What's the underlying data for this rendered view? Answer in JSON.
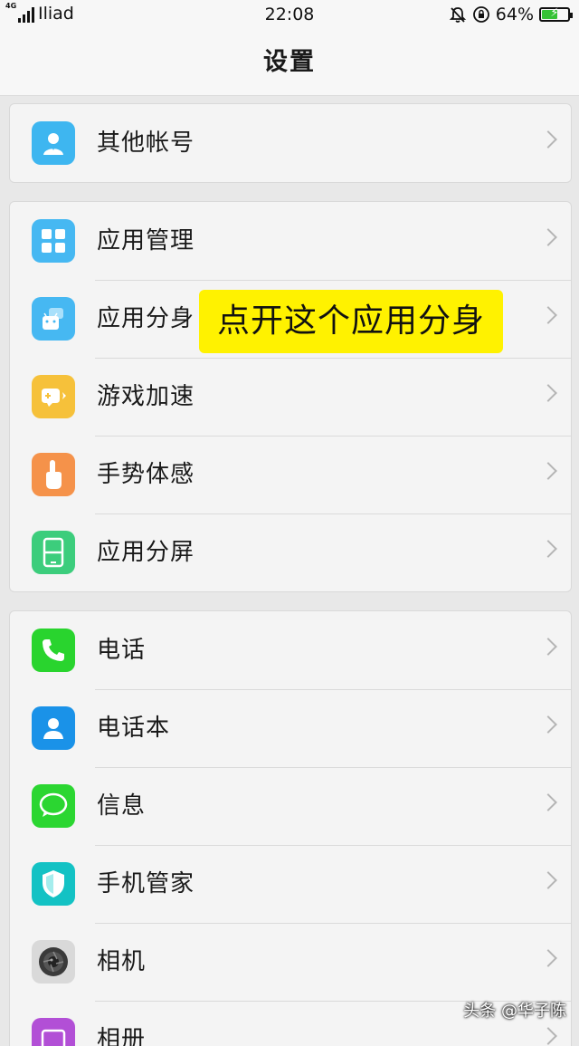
{
  "status": {
    "network": "4G",
    "carrier": "Iliad",
    "time": "22:08",
    "battery": "64%",
    "battery_level": 0.64
  },
  "header": {
    "title": "设置"
  },
  "groups": {
    "g1": [
      {
        "label": "其他帐号",
        "icon": "account-icon"
      }
    ],
    "g2": [
      {
        "label": "应用管理",
        "icon": "app-management-icon"
      },
      {
        "label": "应用分身",
        "icon": "app-clone-icon"
      },
      {
        "label": "游戏加速",
        "icon": "game-boost-icon"
      },
      {
        "label": "手势体感",
        "icon": "gesture-icon"
      },
      {
        "label": "应用分屏",
        "icon": "split-screen-icon"
      }
    ],
    "g3": [
      {
        "label": "电话",
        "icon": "phone-icon"
      },
      {
        "label": "电话本",
        "icon": "contacts-icon"
      },
      {
        "label": "信息",
        "icon": "messages-icon"
      },
      {
        "label": "手机管家",
        "icon": "phone-manager-icon"
      },
      {
        "label": "相机",
        "icon": "camera-icon"
      },
      {
        "label": "相册",
        "icon": "photos-icon"
      }
    ]
  },
  "callout": {
    "text": "点开这个应用分身"
  },
  "watermark": {
    "text": "头条 @华子陈"
  },
  "colors": {
    "highlight": "#fff200",
    "battery": "#35c235"
  }
}
